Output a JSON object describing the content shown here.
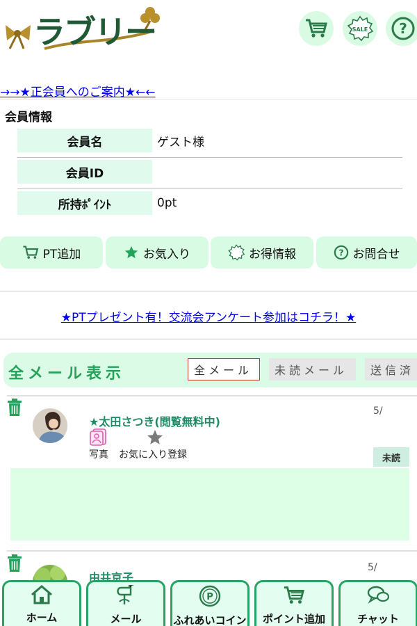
{
  "header": {
    "logo_text": "ラブリー",
    "icons": [
      "cart-icon",
      "sale-icon",
      "help-icon"
    ],
    "sale_badge_text": "SALE"
  },
  "guide_link": "→→★正会員へのご案内★←←",
  "member": {
    "title": "会員情報",
    "rows": [
      {
        "label": "会員名",
        "value": "ゲスト様"
      },
      {
        "label": "会員ID",
        "value": ""
      },
      {
        "label": "所持ﾎﾟｲﾝﾄ",
        "value": "0pt"
      }
    ]
  },
  "menu": [
    {
      "label": "PT追加",
      "icon": "cart-icon"
    },
    {
      "label": "お気入り",
      "icon": "star-icon"
    },
    {
      "label": "お得情報",
      "icon": "sale-icon"
    },
    {
      "label": "お問合せ",
      "icon": "help-icon"
    }
  ],
  "promo_link": "★PTプレゼント有！交流会アンケート参加はコチラ！★",
  "mail": {
    "title": "全メール表示",
    "tabs": [
      "全メール",
      "未読メール",
      "送信済"
    ],
    "items": [
      {
        "sender": "★太田さつき(閲覧無料中)",
        "date": "5/",
        "photo_label": "写真",
        "fav_label": "お気に入り登録",
        "status": "未読"
      },
      {
        "sender": "由井京子",
        "date": "5/"
      }
    ]
  },
  "bottom_nav": [
    {
      "label": "ホーム",
      "icon": "home-icon"
    },
    {
      "label": "メール",
      "icon": "mailbox-icon"
    },
    {
      "label": "ふれあいコイン",
      "icon": "coin-icon"
    },
    {
      "label": "ポイント追加",
      "icon": "cart-icon"
    },
    {
      "label": "チャット",
      "icon": "chat-icon"
    }
  ],
  "colors": {
    "brand_green": "#1f5a34",
    "accent_green": "#24a25a",
    "light_green": "#dcfbe6",
    "link_blue": "#0000ee"
  }
}
